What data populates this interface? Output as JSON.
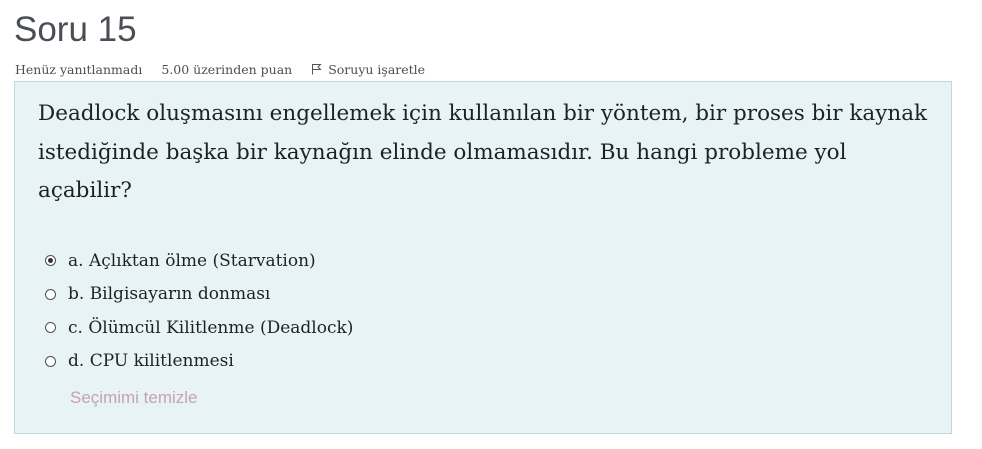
{
  "question": {
    "title": "Soru 15",
    "status": "Henüz yanıtlanmadı",
    "points": "5.00 üzerinden puan",
    "flag_label": "Soruyu işaretle",
    "text": "Deadlock oluşmasını engellemek için kullanılan bir yöntem, bir proses bir kaynak istediğinde başka bir kaynağın elinde olmamasıdır. Bu hangi probleme yol açabilir?",
    "answers": [
      {
        "label": "a. Açlıktan ölme (Starvation)",
        "selected": true
      },
      {
        "label": "b. Bilgisayarın donması",
        "selected": false
      },
      {
        "label": "c. Ölümcül Kilitlenme (Deadlock)",
        "selected": false
      },
      {
        "label": "d. CPU kilitlenmesi",
        "selected": false
      }
    ],
    "clear_choice": "Seçimimi temizle"
  },
  "colors": {
    "box_background": "#e7f3f5",
    "box_border": "#b8dce2",
    "clear_link": "#c7a0bb",
    "title": "#4a4f55"
  },
  "icons": {
    "flag": "flag-outline-icon",
    "radio": "radio-button-icon"
  }
}
